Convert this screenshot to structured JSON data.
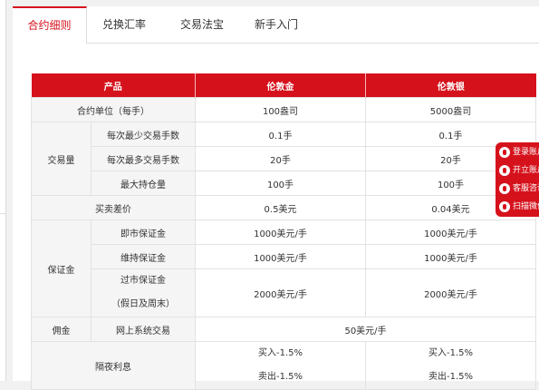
{
  "tabs": [
    "合约细则",
    "兑换汇率",
    "交易法宝",
    "新手入门"
  ],
  "table": {
    "headers": [
      "产品",
      "伦敦金",
      "伦敦银"
    ],
    "contract_unit": {
      "label": "合约单位（每手）",
      "gold": "100盎司",
      "silver": "5000盎司"
    },
    "volume": {
      "group": "交易量",
      "rows": [
        {
          "label": "每次最少交易手数",
          "gold": "0.1手",
          "silver": "0.1手"
        },
        {
          "label": "每次最多交易手数",
          "gold": "20手",
          "silver": "20手"
        },
        {
          "label": "最大持仓量",
          "gold": "100手",
          "silver": "100手"
        }
      ]
    },
    "spread": {
      "label": "买卖差价",
      "gold": "0.5美元",
      "silver": "0.04美元"
    },
    "margin": {
      "group": "保证金",
      "rows": [
        {
          "label": "即市保证金",
          "gold": "1000美元/手",
          "silver": "1000美元/手"
        },
        {
          "label": "维持保证金",
          "gold": "1000美元/手",
          "silver": "1000美元/手"
        }
      ],
      "overnight": {
        "label_line1": "过市保证金",
        "label_line2": "（假日及周末）",
        "gold": "2000美元/手",
        "silver": "2000美元/手"
      }
    },
    "commission": {
      "group": "佣金",
      "label": "网上系统交易",
      "value": "50美元/手"
    },
    "overnight_interest": {
      "label": "隔夜利息",
      "gold_buy": "买入-1.5%",
      "gold_sell": "卖出-1.5%",
      "silver_buy": "买入-1.5%",
      "silver_sell": "卖出-1.5%"
    }
  },
  "side_menu": [
    {
      "icon": "user-icon",
      "label": "登录账户"
    },
    {
      "icon": "open-account-icon",
      "label": "开立账户"
    },
    {
      "icon": "service-icon",
      "label": "客服咨询"
    },
    {
      "icon": "wechat-icon",
      "label": "扫描微信"
    }
  ]
}
